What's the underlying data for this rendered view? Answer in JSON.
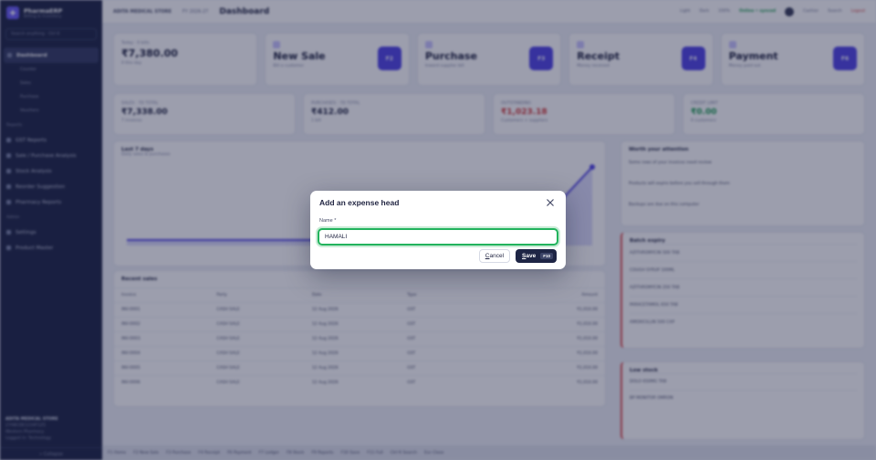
{
  "sidebar": {
    "app_name": "PharmaERP",
    "app_sub": "Billing & Inventory",
    "search_placeholder": "Search anything · Ctrl K",
    "items": [
      {
        "label": "Dashboard",
        "kind": "active"
      },
      {
        "label": "Counter",
        "kind": "sub"
      },
      {
        "label": "Sales",
        "kind": "sub"
      },
      {
        "label": "Purchase",
        "kind": "sub"
      },
      {
        "label": "Vouchers",
        "kind": "sub"
      },
      {
        "label": "Reports",
        "kind": "section"
      },
      {
        "label": "GST Reports",
        "kind": "item"
      },
      {
        "label": "Sale / Purchase Analysis",
        "kind": "item"
      },
      {
        "label": "Stock Analysis",
        "kind": "item"
      },
      {
        "label": "Reorder Suggestion",
        "kind": "item"
      },
      {
        "label": "Pharmacy Reports",
        "kind": "item"
      },
      {
        "label": "Admin",
        "kind": "section"
      },
      {
        "label": "Settings",
        "kind": "item"
      },
      {
        "label": "Product Master",
        "kind": "item"
      }
    ],
    "footer_store": "ADITA MEDICAL STORE",
    "footer_gst": "27ABCDE1234F1Z5",
    "footer_type": "Western Pharmacy",
    "footer_user": "Logged in: Technology",
    "collapse_label": "« Collapse"
  },
  "topbar": {
    "store": "ADITA MEDICAL STORE",
    "fy": "FY 2026-27",
    "title": "Dashboard",
    "items": [
      "Light",
      "Dark",
      "100%"
    ],
    "status_pill": "Online • synced",
    "user": "Cashier",
    "search": "Search",
    "logout": "Logout"
  },
  "cards": [
    {
      "label": "Today · 0 bills",
      "value": "₹7,380.00",
      "sub": "0 this day",
      "fkey": ""
    },
    {
      "label": "",
      "value": "New Sale",
      "sub": "Bill a customer",
      "fkey": "F2"
    },
    {
      "label": "",
      "value": "Purchase",
      "sub": "Inward supplier bill",
      "fkey": "F3"
    },
    {
      "label": "",
      "value": "Receipt",
      "sub": "Money received",
      "fkey": "F4"
    },
    {
      "label": "",
      "value": "Payment",
      "sub": "Money paid out",
      "fkey": "F6"
    }
  ],
  "stats": [
    {
      "label": "SALES · 7D TOTAL",
      "value": "₹7,338.00",
      "sub": "7 invoices",
      "tone": "normal"
    },
    {
      "label": "PURCHASES · 7D TOTAL",
      "value": "₹412.00",
      "sub": "1 bill",
      "tone": "normal"
    },
    {
      "label": "OUTSTANDING",
      "value": "₹1,023.18",
      "sub": "Customers + suppliers",
      "tone": "red"
    },
    {
      "label": "CREDIT LIMIT",
      "value": "₹0.00",
      "sub": "0 customers",
      "tone": "green"
    }
  ],
  "chart": {
    "title": "Last 7 days",
    "sub": "Daily sales & purchases"
  },
  "recent": {
    "title": "Recent sales",
    "columns": [
      "Invoice",
      "Party",
      "Date",
      "Type",
      "Amount"
    ],
    "rows": [
      [
        "INV-0001",
        "CASH SALE",
        "12 Aug 2026",
        "GST",
        "₹1,010.00"
      ],
      [
        "INV-0002",
        "CASH SALE",
        "12 Aug 2026",
        "GST",
        "₹1,010.00"
      ],
      [
        "INV-0003",
        "CASH SALE",
        "12 Aug 2026",
        "GST",
        "₹1,010.00"
      ],
      [
        "INV-0004",
        "CASH SALE",
        "12 Aug 2026",
        "GST",
        "₹1,010.00"
      ],
      [
        "INV-0005",
        "CASH SALE",
        "12 Aug 2026",
        "GST",
        "₹1,010.00"
      ],
      [
        "INV-0006",
        "CASH SALE",
        "12 Aug 2026",
        "GST",
        "₹1,010.00"
      ]
    ]
  },
  "attention": {
    "title": "Worth your attention",
    "lines": [
      "Some rows of your invoices need review",
      "Products will expire before you sell through them",
      "Backups are due on this computer"
    ]
  },
  "expiry": {
    "title": "Batch expiry",
    "rows": [
      "AZITHROMYCIN 500 TAB",
      "COUGH SYRUP 100ML",
      "AZITHROMYCIN 250 TAB",
      "PARACETAMOL 650 TAB",
      "AMOXICILLIN 500 CAP"
    ]
  },
  "lowstock": {
    "title": "Low stock",
    "rows": [
      "DOLO 650MG TAB",
      "BP MONITOR OMRON"
    ]
  },
  "bottombar": {
    "items": [
      "F1 Home",
      "F2 New Sale",
      "F3 Purchase",
      "F4 Receipt",
      "F6 Payment",
      "F7 Ledger",
      "F8 Stock",
      "F9 Reports",
      "F10 Save",
      "F11 Full",
      "Ctrl K Search",
      "Esc Close"
    ]
  },
  "modal": {
    "title": "Add an expense head",
    "name_label": "Name *",
    "name_value": "HAMALI",
    "cancel_first": "C",
    "cancel_rest": "ancel",
    "save_first": "S",
    "save_rest": "ave",
    "save_kbd": "F10"
  },
  "colors": {
    "accent": "#5145e6",
    "focus_ring": "#22b35d",
    "primary_button": "#1e2545",
    "sidebar_bg": "#1e2545"
  }
}
